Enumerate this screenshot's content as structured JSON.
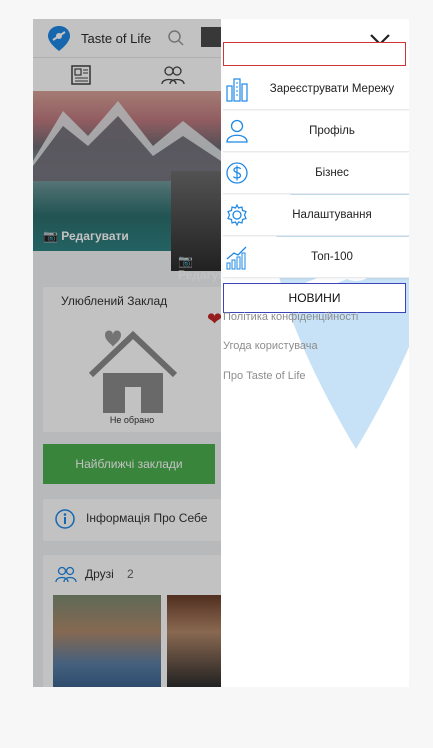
{
  "header": {
    "brand": "Taste of Life"
  },
  "cover": {
    "edit_label": "Редагувати",
    "avatar_edit_label": "Редагувати"
  },
  "favorite": {
    "title": "Улюблений Заклад",
    "none_label": "Не обрано"
  },
  "nearest_button": "Найближчі заклади",
  "info": {
    "label": "Інформація Про Себе"
  },
  "friends": {
    "label": "Друзі",
    "count": "2"
  },
  "menu": {
    "items": [
      {
        "label": "Зареєструвати Мережу",
        "icon": "buildings-icon"
      },
      {
        "label": "Профіль",
        "icon": "user-icon"
      },
      {
        "label": "Бізнес",
        "icon": "dollar-icon"
      },
      {
        "label": "Налаштування",
        "icon": "gear-icon"
      },
      {
        "label": "Топ-100",
        "icon": "chart-icon"
      }
    ],
    "news_label": "НОВИНИ",
    "links": [
      "Політика конфіденційності",
      "Угода користувача",
      "Про Taste of Life"
    ]
  },
  "colors": {
    "accent_blue": "#1e88e5",
    "brand_green": "#4caf50",
    "heart_red": "#c62828",
    "search_border": "#d0343a",
    "news_border": "#3c44b8"
  }
}
